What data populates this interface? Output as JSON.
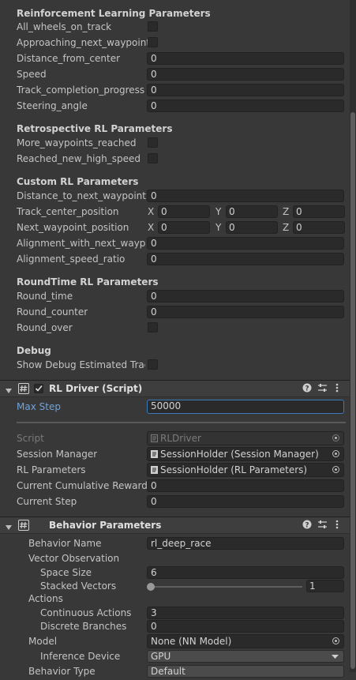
{
  "rl_params": {
    "header": "Reinforcement Learning Parameters",
    "all_wheels": "All_wheels_on_track",
    "approaching": "Approaching_next_waypoint",
    "distance_center": {
      "label": "Distance_from_center",
      "value": "0"
    },
    "speed": {
      "label": "Speed",
      "value": "0"
    },
    "track_completion": {
      "label": "Track_completion_progression",
      "value": "0"
    },
    "steering": {
      "label": "Steering_angle",
      "value": "0"
    }
  },
  "retro": {
    "header": "Retrospective RL Parameters",
    "more_waypoints": "More_waypoints_reached",
    "new_high_speed": "Reached_new_high_speed"
  },
  "custom": {
    "header": "Custom RL Parameters",
    "dist_next": {
      "label": "Distance_to_next_waypoint",
      "value": "0"
    },
    "track_center": {
      "label": "Track_center_position",
      "x": "0",
      "y": "0",
      "z": "0"
    },
    "next_wp": {
      "label": "Next_waypoint_position",
      "x": "0",
      "y": "0",
      "z": "0"
    },
    "alignment": {
      "label": "Alignment_with_next_waypoint",
      "value": "0"
    },
    "align_speed": {
      "label": "Alignment_speed_ratio",
      "value": "0"
    }
  },
  "vec_axes": {
    "x": "X",
    "y": "Y",
    "z": "Z"
  },
  "roundtime": {
    "header": "RoundTime RL Parameters",
    "round_time": {
      "label": "Round_time",
      "value": "0"
    },
    "round_counter": {
      "label": "Round_counter",
      "value": "0"
    },
    "round_over": "Round_over"
  },
  "debug": {
    "header": "Debug",
    "show_track": "Show Debug Estimated Track"
  },
  "rl_driver": {
    "title": "RL Driver (Script)",
    "max_step": {
      "label": "Max Step",
      "value": "50000"
    },
    "script": {
      "label": "Script",
      "value": "RLDriver"
    },
    "session_manager": {
      "label": "Session Manager",
      "value": "SessionHolder (Session Manager)"
    },
    "rl_parameters": {
      "label": "RL Parameters",
      "value": "SessionHolder (RL Parameters)"
    },
    "cumulative": {
      "label": "Current Cumulative Reward",
      "value": "0"
    },
    "current_step": {
      "label": "Current Step",
      "value": "0"
    }
  },
  "behavior": {
    "title": "Behavior Parameters",
    "name": {
      "label": "Behavior Name",
      "value": "rl_deep_race"
    },
    "vector_obs": "Vector Observation",
    "space_size": {
      "label": "Space Size",
      "value": "6"
    },
    "stacked": {
      "label": "Stacked Vectors",
      "value": "1",
      "slider_fraction": 0.0
    },
    "actions": "Actions",
    "continuous": {
      "label": "Continuous Actions",
      "value": "3"
    },
    "discrete": {
      "label": "Discrete Branches",
      "value": "0"
    },
    "model": {
      "label": "Model",
      "value": "None (NN Model)"
    },
    "inference": {
      "label": "Inference Device",
      "value": "GPU"
    },
    "behavior_type": {
      "label": "Behavior Type",
      "value": "Default"
    }
  },
  "icons": {
    "help": "question-icon",
    "presets": "sliders-icon",
    "menu": "kebab-icon",
    "script": "script-hash-icon",
    "fold": "triangle-down-icon",
    "object": "target-icon"
  },
  "colors": {
    "accent": "#3a79bb",
    "panel": "#383838",
    "field": "#2a2a2a",
    "header_bar": "#3e3e3e"
  }
}
